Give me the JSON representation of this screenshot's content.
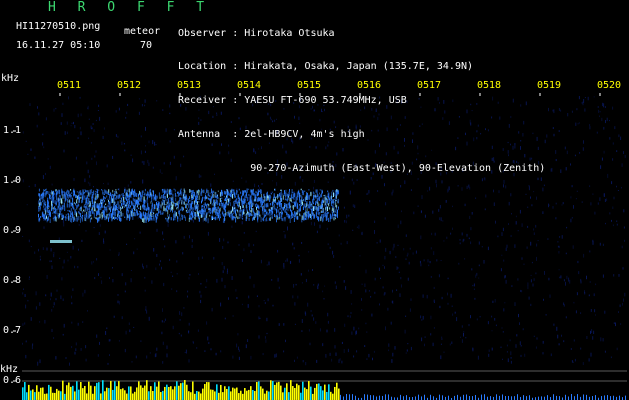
{
  "app": {
    "title": "H R O F F T",
    "filename": "HI11270510.png",
    "datetime": "16.11.27 05:10",
    "meteor_label": "meteor",
    "meteor_count": "70"
  },
  "info": [
    {
      "label": "Observer",
      "value": "Hirotaka Otsuka"
    },
    {
      "label": "Location",
      "value": "Hirakata, Osaka, Japan (135.7E, 34.9N)"
    },
    {
      "label": "Receiver",
      "value": "YAESU FT-690 53.749MHz, USB"
    },
    {
      "label": "Antenna",
      "value": "2el-HB9CV, 4m's high"
    },
    {
      "label": "",
      "value": "90-270-Azimuth (East-West), 90-Elevation (Zenith)"
    }
  ],
  "axis": {
    "y_unit_top": "kHz",
    "y_unit_bottom": "kHz",
    "time_ticks": [
      "0511",
      "0512",
      "0513",
      "0514",
      "0515",
      "0516",
      "0517",
      "0518",
      "0519",
      "0520"
    ],
    "freq_ticks": [
      "1.1",
      "1.0",
      "0.9",
      "0.8",
      "0.7",
      "0.6"
    ],
    "freq_values": [
      1.1,
      1.0,
      0.9,
      0.8,
      0.7,
      0.6
    ]
  },
  "colors": {
    "background": "#000000",
    "title": "#3cd870",
    "tick_label": "#ffff00",
    "noise": "#0a1a66",
    "signal": "#2a7cff",
    "signal_hot": "#9cf0ff",
    "meteor": "#ffff00",
    "meteor_alt": "#00e0ff"
  }
}
